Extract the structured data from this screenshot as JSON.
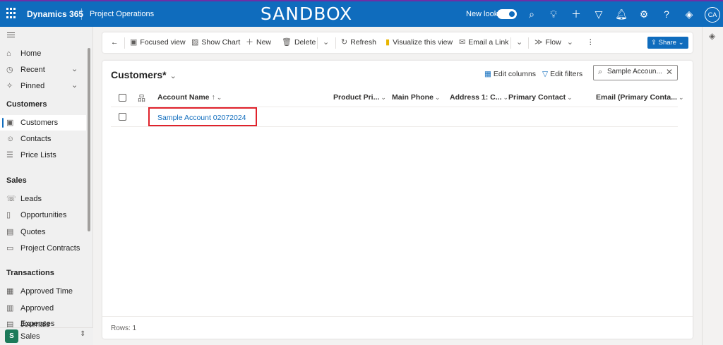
{
  "topbar": {
    "app_name": "Dynamics 365",
    "module_name": "Project Operations",
    "environment_banner": "SANDBOX",
    "new_look_label": "New look",
    "new_look_enabled": true,
    "avatar_initials": "CA",
    "icons": [
      "search-icon",
      "lightbulb-icon",
      "plus-icon",
      "filter-icon",
      "bell-icon",
      "gear-icon",
      "help-icon",
      "copilot-icon"
    ]
  },
  "nav": {
    "top_items": [
      {
        "label": "Home",
        "icon": "home-icon"
      },
      {
        "label": "Recent",
        "icon": "clock-icon"
      },
      {
        "label": "Pinned",
        "icon": "pin-icon"
      }
    ],
    "sections": [
      {
        "title": "Customers",
        "items": [
          {
            "label": "Customers",
            "icon": "building-icon",
            "active": true
          },
          {
            "label": "Contacts",
            "icon": "contact-icon"
          },
          {
            "label": "Price Lists",
            "icon": "list-icon"
          }
        ]
      },
      {
        "title": "Sales",
        "items": [
          {
            "label": "Leads",
            "icon": "phone-icon"
          },
          {
            "label": "Opportunities",
            "icon": "document-icon"
          },
          {
            "label": "Quotes",
            "icon": "quote-icon"
          },
          {
            "label": "Project Contracts",
            "icon": "contract-icon"
          }
        ]
      },
      {
        "title": "Transactions",
        "items": [
          {
            "label": "Approved Time",
            "icon": "calendar-icon"
          },
          {
            "label": "Approved Expenses",
            "icon": "receipt-icon"
          },
          {
            "label": "Journals",
            "icon": "journal-icon"
          }
        ]
      }
    ],
    "area": {
      "badge": "S",
      "label": "Sales"
    }
  },
  "commandbar": {
    "back_label": "←",
    "focused_view": "Focused view",
    "show_chart": "Show Chart",
    "new": "New",
    "delete": "Delete",
    "refresh": "Refresh",
    "visualize": "Visualize this view",
    "email_link": "Email a Link",
    "flow": "Flow",
    "share": "Share"
  },
  "view": {
    "title": "Customers*",
    "edit_columns": "Edit columns",
    "edit_filters": "Edit filters",
    "search_value": "Sample Accoun..."
  },
  "grid": {
    "columns": [
      "Account Name",
      "Product Pri...",
      "Main Phone",
      "Address 1: C...",
      "Primary Contact",
      "Email (Primary Conta..."
    ],
    "sort_indicator": "↑",
    "rows": [
      {
        "account_name": "Sample Account 02072024"
      }
    ],
    "footer": "Rows: 1"
  }
}
